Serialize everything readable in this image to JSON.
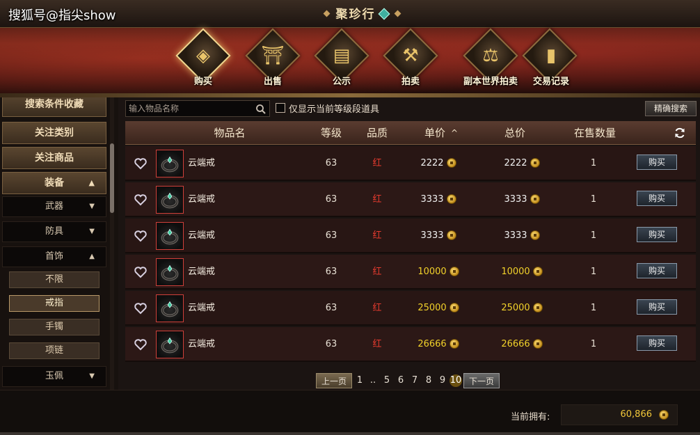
{
  "watermark": "搜狐号@指尖show",
  "window_title": "聚珍行",
  "categories": [
    {
      "label": "购买",
      "icon": "coin-icon",
      "active": true
    },
    {
      "label": "出售",
      "icon": "stall-icon"
    },
    {
      "label": "公示",
      "icon": "scroll-icon"
    },
    {
      "label": "拍卖",
      "icon": "gavel-icon"
    },
    {
      "label": "副本世界拍卖",
      "icon": "gavel-world-icon"
    },
    {
      "label": "交易记录",
      "icon": "book-icon"
    }
  ],
  "sidebar": {
    "saved_search": "搜索条件收藏",
    "followed_categories": "关注类别",
    "followed_items": "关注商品",
    "equipment": "装备",
    "weapons": "武器",
    "armor": "防具",
    "accessories": "首饰",
    "leaf_items": [
      "不限",
      "戒指",
      "手镯",
      "项链"
    ],
    "selected_leaf": "戒指",
    "jade": "玉佩"
  },
  "search": {
    "placeholder": "输入物品名称",
    "filter_label": "仅显示当前等级段道具",
    "exact_search": "精确搜索"
  },
  "table": {
    "headers": {
      "name": "物品名",
      "level": "等级",
      "quality": "品质",
      "unit_price": "单价",
      "sort_arrow": "^",
      "total_price": "总价",
      "quantity": "在售数量"
    },
    "buy_label": "购买",
    "rows": [
      {
        "name": "云端戒",
        "level": "63",
        "quality": "红",
        "unit_price": "2222",
        "total_price": "2222",
        "quantity": "1",
        "price_color": "white"
      },
      {
        "name": "云端戒",
        "level": "63",
        "quality": "红",
        "unit_price": "3333",
        "total_price": "3333",
        "quantity": "1",
        "price_color": "white"
      },
      {
        "name": "云端戒",
        "level": "63",
        "quality": "红",
        "unit_price": "3333",
        "total_price": "3333",
        "quantity": "1",
        "price_color": "white"
      },
      {
        "name": "云端戒",
        "level": "63",
        "quality": "红",
        "unit_price": "10000",
        "total_price": "10000",
        "quantity": "1",
        "price_color": "gold"
      },
      {
        "name": "云端戒",
        "level": "63",
        "quality": "红",
        "unit_price": "25000",
        "total_price": "25000",
        "quantity": "1",
        "price_color": "gold"
      },
      {
        "name": "云端戒",
        "level": "63",
        "quality": "红",
        "unit_price": "26666",
        "total_price": "26666",
        "quantity": "1",
        "price_color": "gold"
      }
    ]
  },
  "pager": {
    "prev": "上一页",
    "next": "下一页",
    "pages": [
      "1",
      "..",
      "5",
      "6",
      "7",
      "8",
      "9",
      "10"
    ],
    "current": "10"
  },
  "footer": {
    "owned_label": "当前拥有:",
    "owned_value": "60,866"
  },
  "colors": {
    "quality_red": "#e33a2e",
    "gold_price": "#f2d22a",
    "accent_gold": "#e9c46a"
  }
}
